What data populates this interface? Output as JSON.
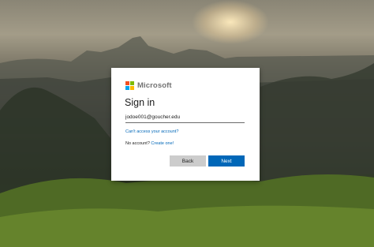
{
  "brand": {
    "name": "Microsoft",
    "colors": [
      "#f25022",
      "#7fba00",
      "#00a4ef",
      "#ffb900"
    ]
  },
  "signin": {
    "title": "Sign in",
    "email_value": "jodoe001@goucher.edu",
    "cant_access_link": "Can't access your account?",
    "no_account_text": "No account?",
    "create_link": "Create one!",
    "back_label": "Back",
    "next_label": "Next"
  },
  "colors": {
    "accent": "#0067b8",
    "secondary_button": "#cccccc"
  }
}
